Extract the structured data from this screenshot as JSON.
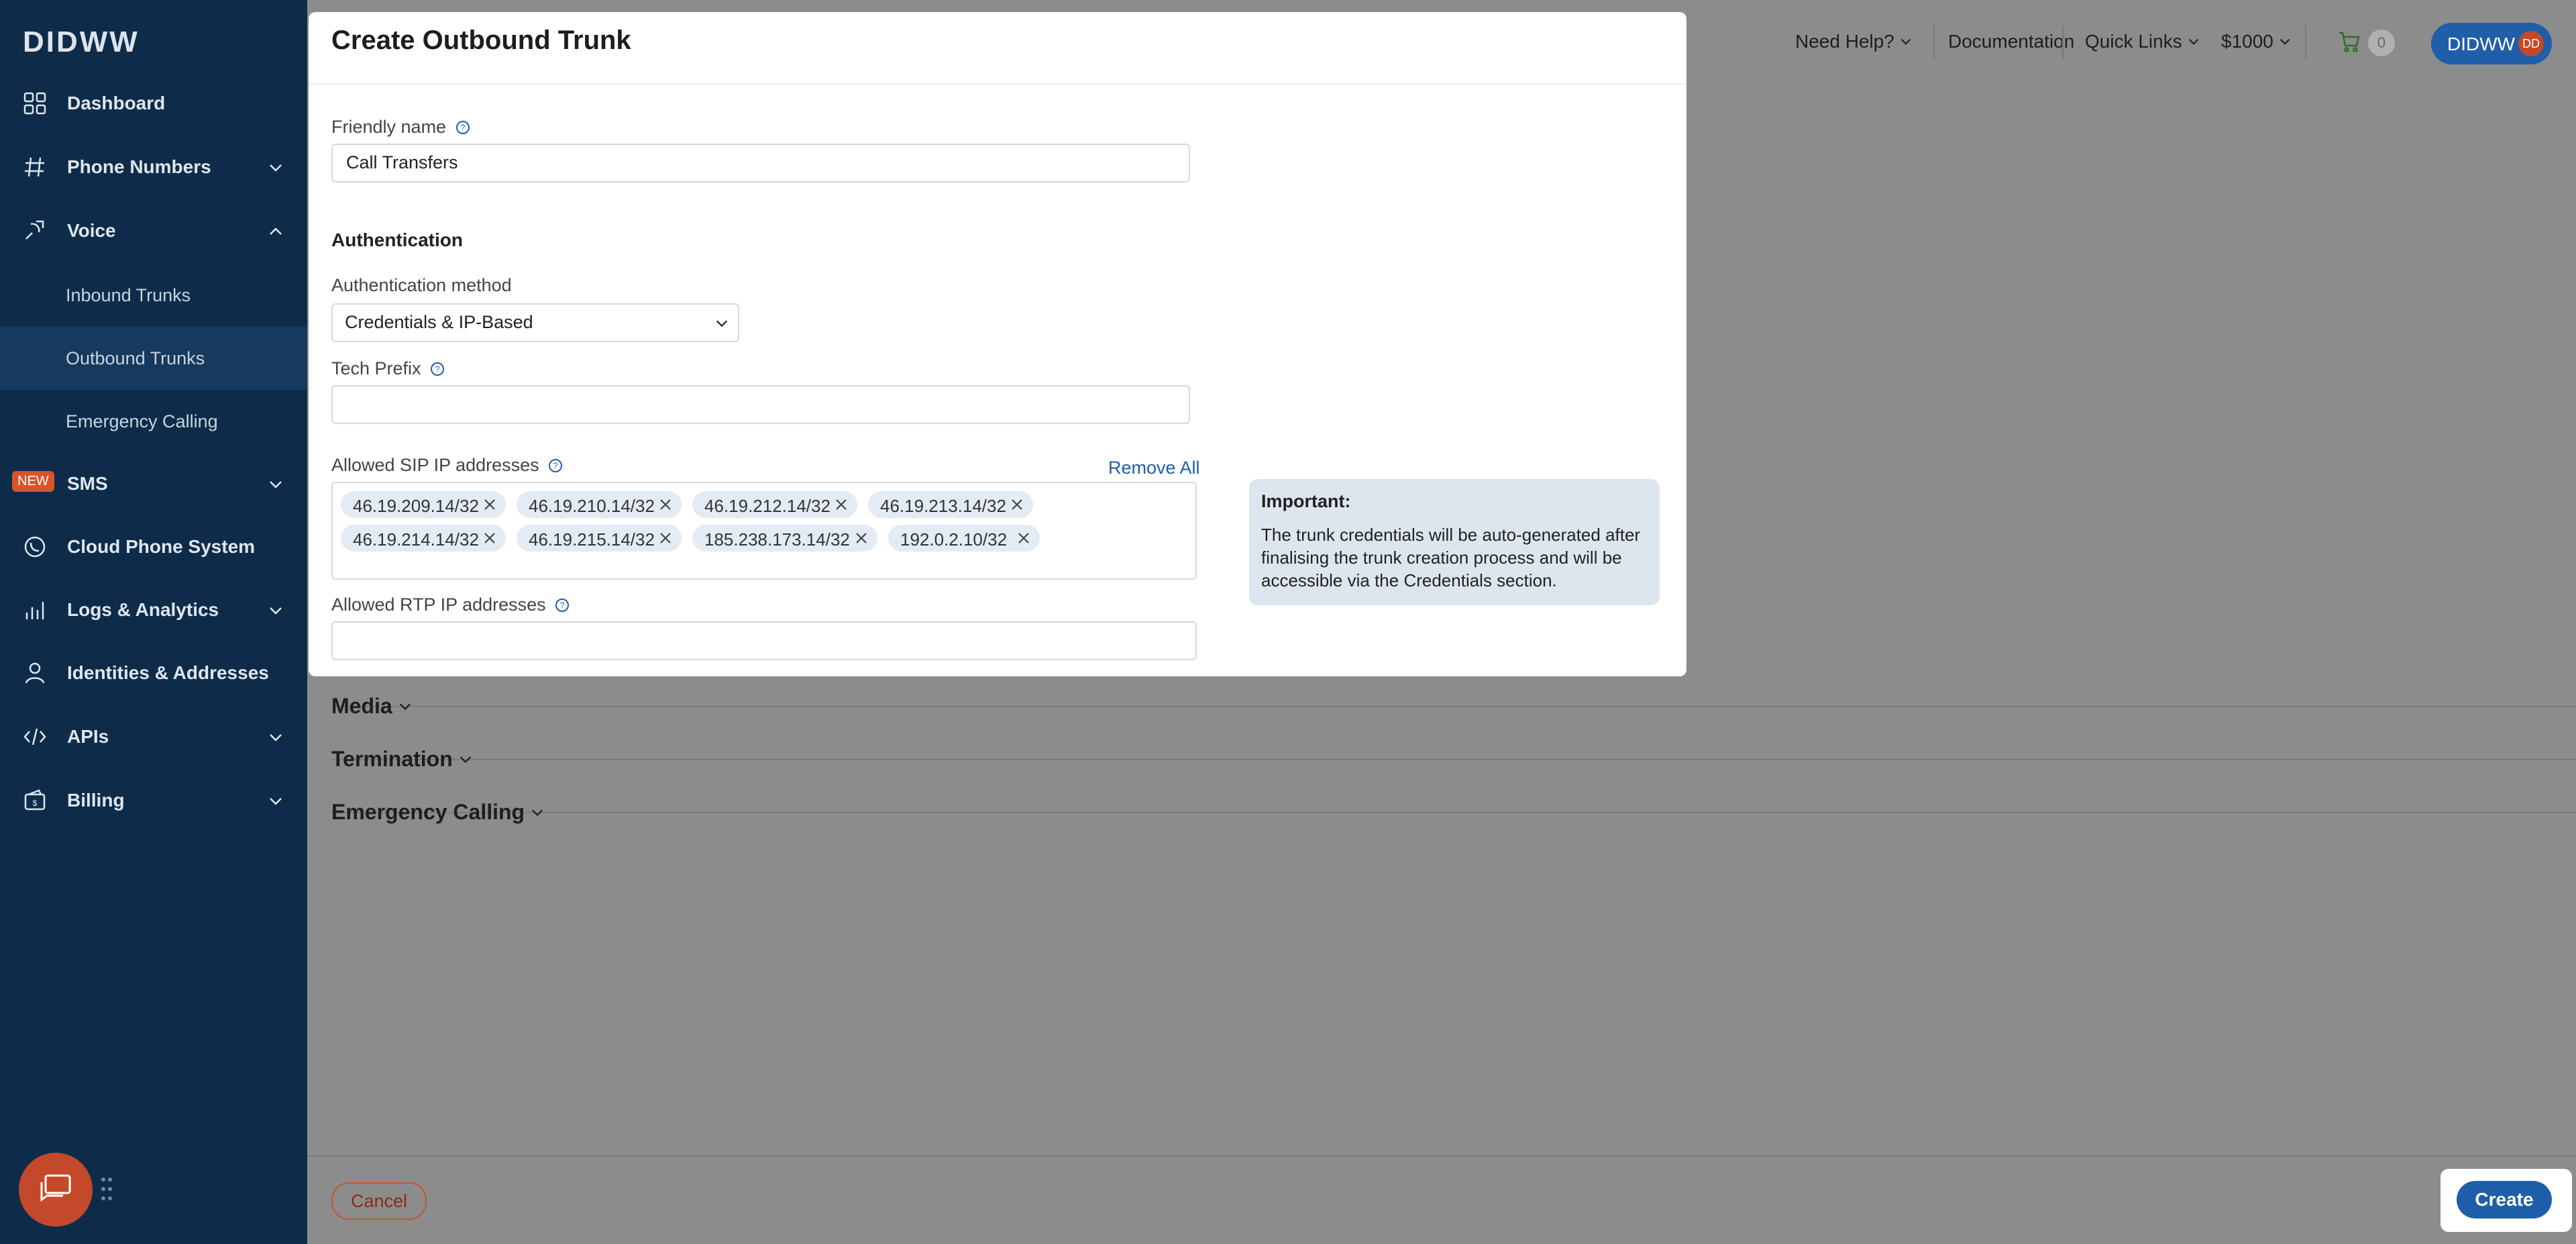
{
  "brand": {
    "logo_text": "DIDWW"
  },
  "sidebar": {
    "items": [
      {
        "label": "Dashboard",
        "icon": "dashboard-grid-icon"
      },
      {
        "label": "Phone Numbers",
        "icon": "hash-icon"
      },
      {
        "label": "Voice",
        "icon": "voice-icon"
      },
      {
        "label": "SMS",
        "icon": "sms-icon",
        "badge": "NEW"
      },
      {
        "label": "Cloud Phone System",
        "icon": "phone-icon"
      },
      {
        "label": "Logs & Analytics",
        "icon": "bar-chart-icon"
      },
      {
        "label": "Identities & Addresses",
        "icon": "user-icon"
      },
      {
        "label": "APIs",
        "icon": "code-icon"
      },
      {
        "label": "Billing",
        "icon": "wallet-icon"
      }
    ],
    "voice_subitems": [
      {
        "label": "Inbound Trunks"
      },
      {
        "label": "Outbound Trunks"
      },
      {
        "label": "Emergency Calling"
      }
    ],
    "active_color": "#163a5e",
    "bg_color": "#0e2c4a"
  },
  "topbar": {
    "need_help": "Need Help?",
    "documentation": "Documentation",
    "quick_links": "Quick Links",
    "balance": "$1000",
    "cart_count": "0",
    "user_label": "DIDWW",
    "user_initials": "DD"
  },
  "modal": {
    "title": "Create Outbound Trunk",
    "friendly_name_label": "Friendly name",
    "friendly_name_value": "Call Transfers",
    "auth_section_title": "Authentication",
    "auth_method_label": "Authentication method",
    "auth_method_value": "Credentials & IP-Based",
    "tech_prefix_label": "Tech Prefix",
    "tech_prefix_value": "",
    "sip_label": "Allowed SIP IP addresses",
    "remove_all": "Remove All",
    "sip_addresses": [
      "46.19.209.14/32",
      "46.19.210.14/32",
      "46.19.212.14/32",
      "46.19.213.14/32",
      "46.19.214.14/32",
      "46.19.215.14/32",
      "185.238.173.14/32",
      "192.0.2.10/32"
    ],
    "rtp_label": "Allowed RTP IP addresses",
    "rtp_value": "",
    "important_title": "Important:",
    "important_text": "The trunk credentials will be auto-generated after finalising the trunk creation process and will be accessible via the Credentials section."
  },
  "sections": [
    {
      "label": "Media"
    },
    {
      "label": "Termination"
    },
    {
      "label": "Emergency Calling"
    }
  ],
  "footer": {
    "cancel_label": "Cancel",
    "create_label": "Create"
  },
  "colors": {
    "primary": "#1f5ea8",
    "link": "#1f5ea8",
    "cancel_border": "#c0562a",
    "overlay": "#8c8c8c"
  }
}
